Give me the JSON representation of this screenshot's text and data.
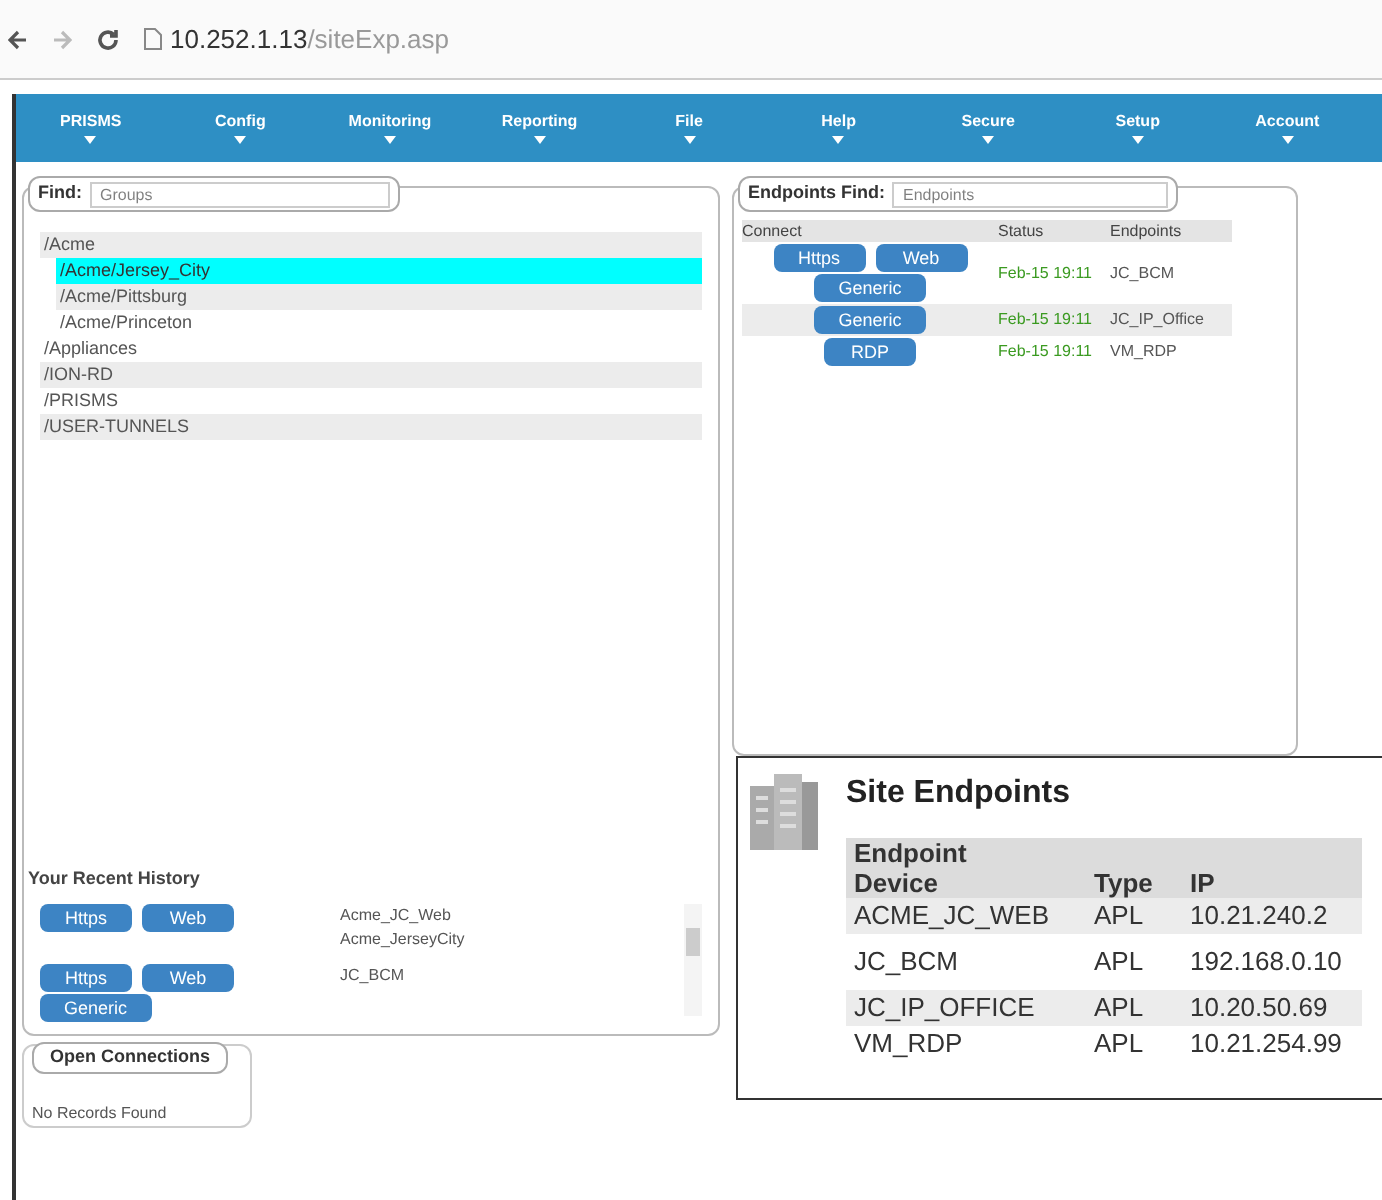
{
  "browser": {
    "url_host": "10.252.1.13",
    "url_path": "/siteExp.asp"
  },
  "menu": [
    "PRISMS",
    "Config",
    "Monitoring",
    "Reporting",
    "File",
    "Help",
    "Secure",
    "Setup",
    "Account"
  ],
  "groups": {
    "find_label": "Find:",
    "placeholder": "Groups",
    "tree": [
      {
        "label": "/Acme",
        "selected": false,
        "children": [
          {
            "label": "/Acme/Jersey_City",
            "selected": true
          },
          {
            "label": "/Acme/Pittsburg",
            "selected": false
          },
          {
            "label": "/Acme/Princeton",
            "selected": false
          }
        ]
      },
      {
        "label": "/Appliances",
        "selected": false
      },
      {
        "label": "/ION-RD",
        "selected": false
      },
      {
        "label": "/PRISMS",
        "selected": false
      },
      {
        "label": "/USER-TUNNELS",
        "selected": false
      }
    ]
  },
  "history": {
    "title": "Your Recent History",
    "rows": [
      {
        "buttons": [
          "Https",
          "Web"
        ],
        "names": [
          "Acme_JC_Web",
          "Acme_JerseyCity"
        ]
      },
      {
        "buttons": [
          "Https",
          "Web",
          "Generic"
        ],
        "names": [
          "JC_BCM"
        ]
      }
    ]
  },
  "open_connections": {
    "title": "Open Connections",
    "message": "No Records Found"
  },
  "endpoints": {
    "find_label": "Endpoints Find:",
    "placeholder": "Endpoints",
    "columns": [
      "Connect",
      "Status",
      "Endpoints"
    ],
    "rows": [
      {
        "buttons": [
          "Https",
          "Web",
          "Generic"
        ],
        "status": "Feb-15 19:11",
        "endpoint": "JC_BCM"
      },
      {
        "buttons": [
          "Generic"
        ],
        "status": "Feb-15 19:11",
        "endpoint": "JC_IP_Office"
      },
      {
        "buttons": [
          "RDP"
        ],
        "status": "Feb-15 19:11",
        "endpoint": "VM_RDP"
      }
    ]
  },
  "site_endpoints": {
    "title": "Site Endpoints",
    "columns": [
      "Endpoint Device",
      "Type",
      "IP"
    ],
    "rows": [
      [
        "ACME_JC_WEB",
        "APL",
        "10.21.240.2"
      ],
      [
        "JC_BCM",
        "APL",
        "192.168.0.10"
      ],
      [
        "JC_IP_OFFICE",
        "APL",
        "10.20.50.69"
      ],
      [
        "VM_RDP",
        "APL",
        "10.21.254.99"
      ]
    ]
  }
}
